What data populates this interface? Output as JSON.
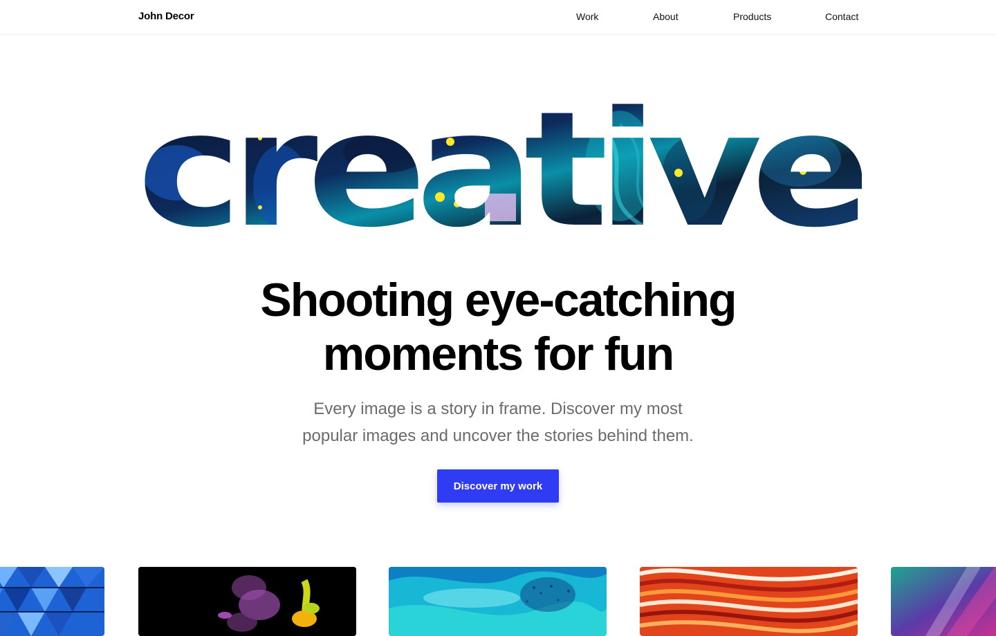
{
  "nav": {
    "brand": "John Decor",
    "links": [
      "Work",
      "About",
      "Products",
      "Contact"
    ]
  },
  "hero": {
    "word": "creative",
    "headline_line1": "Shooting eye-catching",
    "headline_line2": "moments for fun",
    "subtitle": "Every image is a story in frame. Discover my most popular images and uncover the stories behind them.",
    "cta_label": "Discover my work"
  },
  "gallery": {
    "items": [
      "blue-geometric-panels",
      "colored-smoke-on-black",
      "turquoise-fluid-art",
      "orange-red-swirl",
      "neon-gradient-light"
    ]
  },
  "colors": {
    "accent": "#2f3cf4",
    "text": "#000000",
    "muted": "#6b6b6b"
  }
}
